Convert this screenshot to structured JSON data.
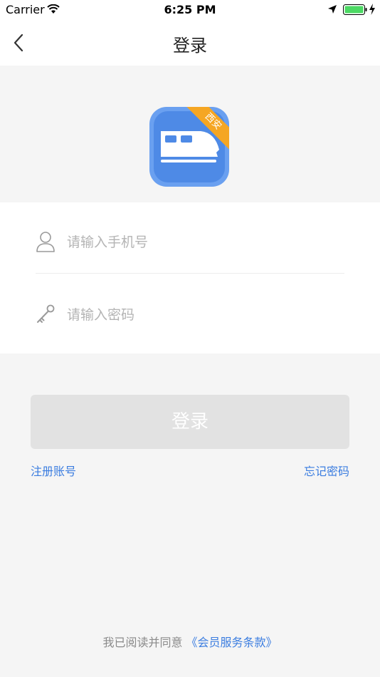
{
  "status_bar": {
    "carrier": "Carrier",
    "time": "6:25 PM",
    "icons": [
      "wifi-icon",
      "location-arrow-icon",
      "battery-icon",
      "charging-icon"
    ]
  },
  "nav": {
    "title": "登录",
    "back_icon": "chevron-left-icon"
  },
  "logo": {
    "badge_text": "西安",
    "icon": "train-app-icon",
    "colors": {
      "blue": "#4e8ae6",
      "light_blue": "#6aa0f0",
      "badge": "#f5a623"
    }
  },
  "form": {
    "phone": {
      "value": "",
      "placeholder": "请输入手机号",
      "icon": "user-icon"
    },
    "password": {
      "value": "",
      "placeholder": "请输入密码",
      "icon": "key-icon"
    }
  },
  "actions": {
    "login_label": "登录",
    "register_label": "注册账号",
    "forgot_label": "忘记密码"
  },
  "terms": {
    "prefix": "我已阅读并同意",
    "link_text": "《会员服务条款》"
  },
  "colors": {
    "accent": "#3b7de0",
    "button_disabled": "#e2e2e2",
    "background": "#f5f5f5"
  }
}
